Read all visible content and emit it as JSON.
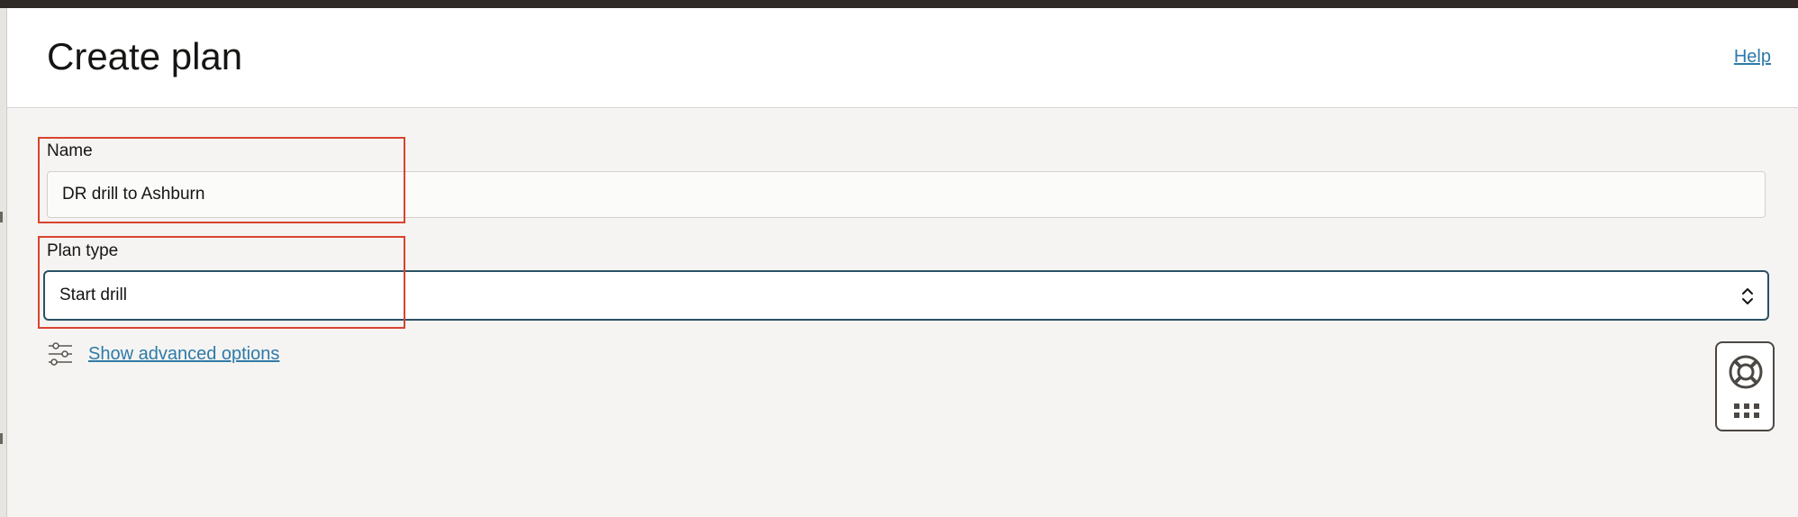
{
  "header": {
    "title": "Create plan",
    "help_label": "Help"
  },
  "form": {
    "name_label": "Name",
    "name_value": "DR drill to Ashburn",
    "plan_type_label": "Plan type",
    "plan_type_value": "Start drill",
    "advanced_options_label": "Show advanced options"
  },
  "icons": {
    "select_chevron": "chevron-up-down-icon",
    "advanced_options": "sliders-icon",
    "help_widget": "lifebuoy-icon",
    "launcher": "grid-icon"
  },
  "colors": {
    "highlight": "#d9432f",
    "link": "#2e7aa8",
    "focus_border": "#2b5064"
  }
}
